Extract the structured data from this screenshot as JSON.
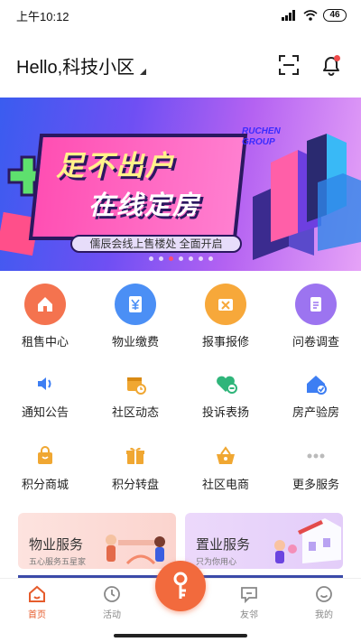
{
  "status": {
    "time": "上午10:12",
    "battery": "46"
  },
  "header": {
    "greeting": "Hello,科技小区"
  },
  "banner": {
    "line1": "足不出户",
    "line2": "在线定房",
    "brand_top": "RUCHEN",
    "brand_bottom": "GROUP",
    "tagline": "儒辰会线上售楼处 全面开启",
    "slides": 7,
    "active_slide": 2
  },
  "services_primary": [
    {
      "label": "租售中心",
      "color": "#f4734f",
      "icon": "home-icon"
    },
    {
      "label": "物业缴费",
      "color": "#4b8ff5",
      "icon": "yen-icon"
    },
    {
      "label": "报事报修",
      "color": "#f7a83a",
      "icon": "tools-icon"
    },
    {
      "label": "问卷调查",
      "color": "#9c74f0",
      "icon": "clipboard-icon"
    }
  ],
  "services_secondary": [
    {
      "label": "通知公告",
      "color": "#3d7ef3",
      "icon": "speaker-icon"
    },
    {
      "label": "社区动态",
      "color": "#f0a732",
      "icon": "calendar-clock-icon"
    },
    {
      "label": "投诉表扬",
      "color": "#2fb57a",
      "icon": "heart-icon"
    },
    {
      "label": "房产验房",
      "color": "#3d7ef3",
      "icon": "house-check-icon"
    }
  ],
  "services_tertiary": [
    {
      "label": "积分商城",
      "color": "#f0a732",
      "icon": "shopping-bag-icon"
    },
    {
      "label": "积分转盘",
      "color": "#f0a732",
      "icon": "gift-icon"
    },
    {
      "label": "社区电商",
      "color": "#f0a732",
      "icon": "basket-icon"
    },
    {
      "label": "更多服务",
      "color": "#bbbbbb",
      "icon": "more-dots-icon"
    }
  ],
  "cards": [
    {
      "title": "物业服务",
      "subtitle": "五心服务五星家"
    },
    {
      "title": "置业服务",
      "subtitle": "只为你用心"
    }
  ],
  "tabs": [
    {
      "label": "首页",
      "icon": "home-tab-icon"
    },
    {
      "label": "活动",
      "icon": "activity-icon"
    },
    {
      "label": "友邻",
      "icon": "chat-icon"
    },
    {
      "label": "我的",
      "icon": "profile-icon"
    }
  ],
  "colors": {
    "accent": "#f26a3d",
    "active_tab": "#e65c2c"
  }
}
